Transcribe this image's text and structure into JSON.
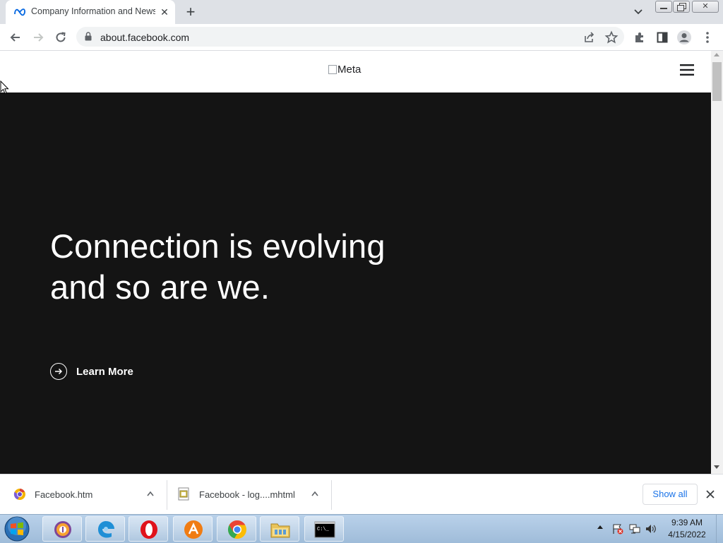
{
  "browser": {
    "tab": {
      "title": "Company Information and News",
      "favicon": "meta-icon",
      "close_icon": "close-icon"
    },
    "new_tab_icon": "plus-icon",
    "tab_search_icon": "chevron-down-icon",
    "window_controls": [
      "minimize-icon",
      "restore-icon",
      "close-icon"
    ],
    "toolbar": {
      "back_icon": "arrow-left-icon",
      "forward_icon": "arrow-right-icon",
      "reload_icon": "reload-icon",
      "url": "about.facebook.com",
      "share_icon": "share-icon",
      "bookmark_icon": "star-icon",
      "extensions_icon": "puzzle-icon",
      "sidepanel_icon": "side-panel-icon",
      "profile_icon": "profile-icon",
      "menu_icon": "kebab-menu-icon"
    }
  },
  "page": {
    "logo_alt": "Meta",
    "menu_icon": "hamburger-icon",
    "hero": {
      "title_line1": "Connection is evolving",
      "title_line2": "and so are we.",
      "cta_label": "Learn More",
      "cta_icon": "arrow-right-circle-icon",
      "background": "#141414"
    }
  },
  "downloads": {
    "items": [
      {
        "name": "Facebook.htm",
        "icon": "chrome-file-icon"
      },
      {
        "name": "Facebook - log....mhtml",
        "icon": "mhtml-file-icon"
      }
    ],
    "show_all_label": "Show all",
    "close_icon": "close-icon"
  },
  "taskbar": {
    "start_icon": "windows-start-icon",
    "apps": [
      "tor-browser-icon",
      "edge-icon",
      "opera-icon",
      "avast-icon",
      "chrome-icon",
      "file-explorer-icon",
      "cmd-icon"
    ],
    "tray_icons": [
      "show-hidden-icons",
      "action-center-flag-icon",
      "network-icon",
      "volume-icon"
    ],
    "clock": {
      "time": "9:39 AM",
      "date": "4/15/2022"
    }
  },
  "colors": {
    "accent": "#1a73e8",
    "hero_bg": "#141414",
    "tab_strip": "#dee1e6"
  }
}
